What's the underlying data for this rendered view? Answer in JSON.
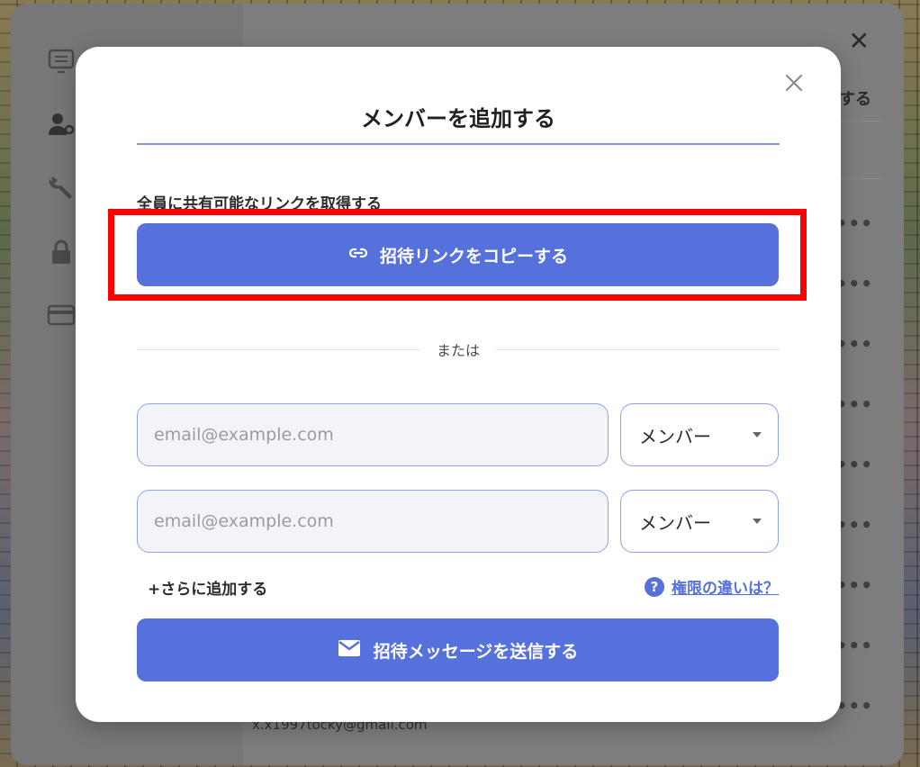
{
  "background": {
    "header_action": "する",
    "row_menu_icon": "•••",
    "close_label": "✕",
    "member_email": "x.x1997tocky@gmail.com"
  },
  "modal": {
    "title": "メンバーを追加する",
    "section_label": "全員に共有可能なリンクを取得する",
    "copy_button_label": "招待リンクをコピーする",
    "copy_button_icon": "link-icon",
    "divider_text": "または",
    "invite_rows": [
      {
        "email_value": "",
        "email_placeholder": "email@example.com",
        "role": "メンバー"
      },
      {
        "email_value": "",
        "email_placeholder": "email@example.com",
        "role": "メンバー"
      }
    ],
    "add_more_label": "+さらに追加する",
    "permissions_link_label": "権限の違いは？",
    "send_button_label": "招待メッセージを送信する",
    "send_button_icon": "mail-icon"
  },
  "colors": {
    "accent": "#5670dc",
    "highlight": "#ff0000",
    "title_rule": "#7d94e3"
  }
}
